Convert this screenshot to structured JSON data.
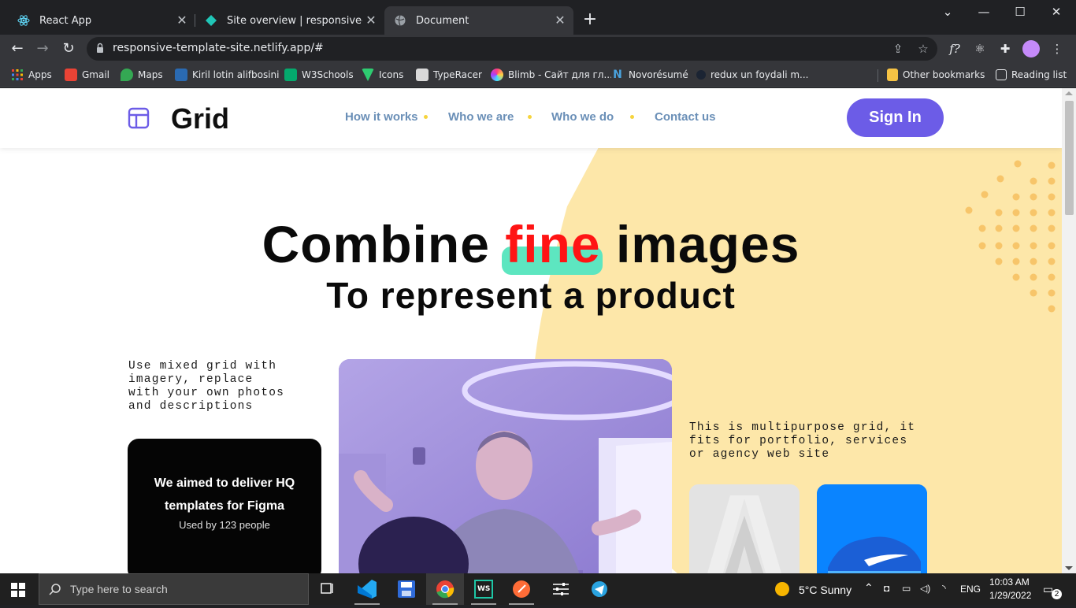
{
  "browser": {
    "tabs": [
      {
        "title": "React App",
        "active": false
      },
      {
        "title": "Site overview | responsive-templ",
        "active": false
      },
      {
        "title": "Document",
        "active": true
      }
    ],
    "new_tab_icon": "plus-icon",
    "url": "responsive-template-site.netlify.app/#",
    "bookmarks": [
      "Apps",
      "Gmail",
      "Maps",
      "Kiril lotin alifbosini",
      "W3Schools",
      "Icons",
      "TypeRacer",
      "Blimb - Сайт для гл...",
      "Novorésumé",
      "redux un foydali m..."
    ],
    "other_bookmarks": "Other bookmarks",
    "reading_list": "Reading list"
  },
  "site": {
    "logo": "Grid",
    "nav": [
      "How it works",
      "Who we are",
      "Who we do",
      "Contact us"
    ],
    "signin": "Sign In",
    "hero": {
      "title_before": "Combine",
      "title_accent": "fine",
      "title_after": "images",
      "subtitle": "To represent a product"
    },
    "left_desc": "Use mixed grid with imagery, replace with your own photos and descriptions",
    "right_desc": "This is multipurpose grid, it fits for portfolio, services or agency web site",
    "dark_card": {
      "heading": "We aimed to deliver HQ templates for Figma",
      "sub": "Used by 123 people"
    },
    "colors": {
      "accent_red": "#ff1414",
      "highlight": "#5de6c0",
      "button": "#6c5ce7",
      "shape": "#fde7a9",
      "dots": "#f7c56a",
      "nav": "#6a8fb7"
    }
  },
  "taskbar": {
    "search_placeholder": "Type here to search",
    "weather": "5°C  Sunny",
    "lang": "ENG",
    "time": "10:03 AM",
    "date": "1/29/2022",
    "notifications": "2"
  }
}
